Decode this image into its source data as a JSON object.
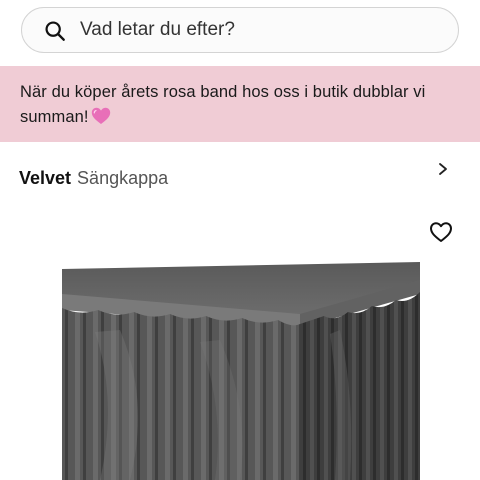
{
  "search": {
    "placeholder": "Vad letar du efter?",
    "icon": "search-icon"
  },
  "promo_banner": {
    "text": "När du köper årets rosa band hos oss i butik dubblar vi summan!",
    "emoji": "pink-heart",
    "background": "#f0ccd5",
    "chevron_icon": "chevron-right-icon"
  },
  "product": {
    "brand": "Velvet",
    "type": "Sängkappa",
    "wishlist_icon": "heart-outline-icon",
    "image": "grey-velvet-bed-skirt"
  }
}
